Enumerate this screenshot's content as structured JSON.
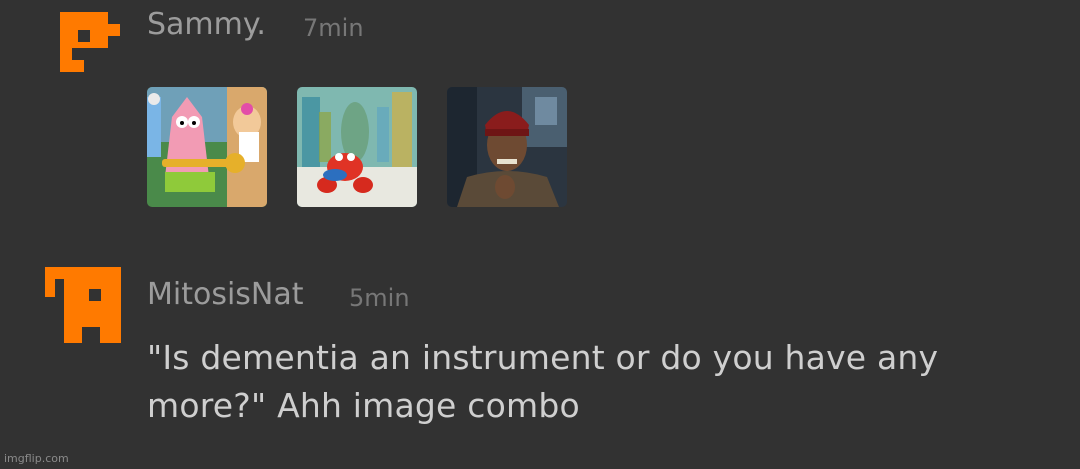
{
  "comments": [
    {
      "username": "Sammy.",
      "timestamp": "7min",
      "avatar_color": "#ff7a00",
      "images": [
        {
          "name": "patrick-trumpet-meme-image"
        },
        {
          "name": "mr-krabs-blur-meme-image"
        },
        {
          "name": "yall-got-any-more-meme-image"
        }
      ]
    },
    {
      "username": "MitosisNat",
      "timestamp": "5min",
      "avatar_color": "#ff7a00",
      "message": "\"Is dementia an instrument or do you have any more?\" Ahh image combo"
    }
  ],
  "watermark": "imgflip.com",
  "colors": {
    "background": "#323232",
    "username": "#9c9c9c",
    "timestamp": "#777777",
    "message": "#cfcfcf",
    "avatar": "#ff7a00"
  }
}
